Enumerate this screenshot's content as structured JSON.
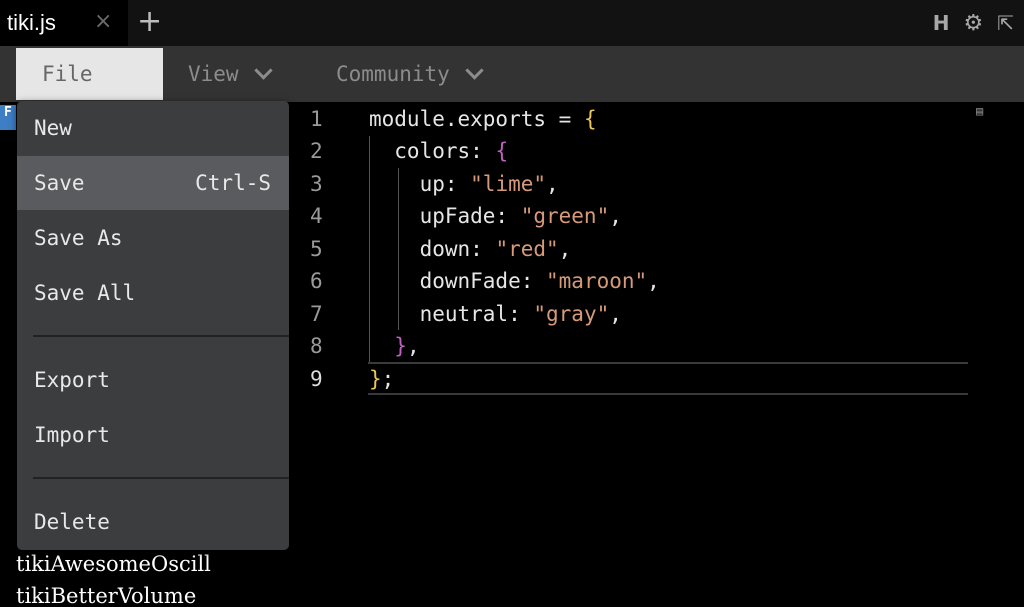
{
  "tab": {
    "title": "tiki.js",
    "close": "×",
    "add": "+"
  },
  "topbar_icons": {
    "h": "H",
    "gear": "⚙",
    "expand": "⇱"
  },
  "menubar": {
    "file": "File",
    "view": "View",
    "community": "Community"
  },
  "file_menu": {
    "items": [
      {
        "label": "New",
        "shortcut": ""
      },
      {
        "label": "Save",
        "shortcut": "Ctrl-S"
      },
      {
        "label": "Save As",
        "shortcut": ""
      },
      {
        "label": "Save All",
        "shortcut": ""
      },
      {
        "label": "Export",
        "shortcut": ""
      },
      {
        "label": "Import",
        "shortcut": ""
      },
      {
        "label": "Delete",
        "shortcut": ""
      }
    ]
  },
  "sidebar": {
    "badge": "F",
    "items": [
      "tikiAwesomeOscill",
      "tikiBetterVolume"
    ]
  },
  "editor": {
    "line_numbers": [
      "1",
      "2",
      "3",
      "4",
      "5",
      "6",
      "7",
      "8",
      "9"
    ],
    "lines": [
      {
        "a": "module.exports = ",
        "b": "{",
        "c": ""
      },
      {
        "a": "  colors: ",
        "b": "{",
        "c": ""
      },
      {
        "a": "    up: ",
        "b": "\"lime\"",
        "c": ","
      },
      {
        "a": "    upFade: ",
        "b": "\"green\"",
        "c": ","
      },
      {
        "a": "    down: ",
        "b": "\"red\"",
        "c": ","
      },
      {
        "a": "    downFade: ",
        "b": "\"maroon\"",
        "c": ","
      },
      {
        "a": "    neutral: ",
        "b": "\"gray\"",
        "c": ","
      },
      {
        "a": "  ",
        "b": "}",
        "c": ","
      },
      {
        "a": "",
        "b": "}",
        "c": ";"
      }
    ]
  },
  "colors": {
    "accent_file": "#e6e6e6",
    "menu_active": "#5a5b5e",
    "string": "#d69a7a"
  }
}
